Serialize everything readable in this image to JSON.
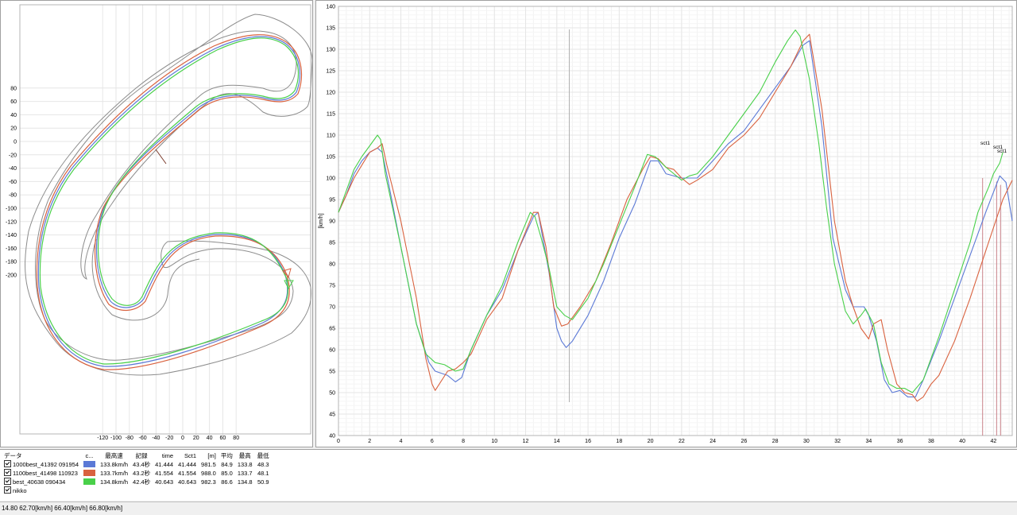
{
  "colors": {
    "blue": "#5b79d6",
    "red": "#d9623f",
    "green": "#49d04a",
    "boundary": "#8c8c8c",
    "grid": "#e6e6e6"
  },
  "track_map": {
    "x_ticks": [
      "-120",
      "-100",
      "-80",
      "-60",
      "-40",
      "-20",
      "0",
      "20",
      "40",
      "60",
      "80"
    ],
    "y_ticks": [
      "80",
      "60",
      "40",
      "20",
      "0",
      "-20",
      "-40",
      "-60",
      "-80",
      "-100",
      "-120",
      "-140",
      "-160",
      "-180",
      "-200"
    ]
  },
  "chart_data": {
    "type": "line",
    "ylabel": "[km/h]",
    "xlim": [
      0,
      43.2
    ],
    "ylim": [
      40,
      140
    ],
    "x_ticks": [
      "0",
      "2",
      "4",
      "6",
      "8",
      "10",
      "12",
      "14",
      "16",
      "18",
      "20",
      "22",
      "24",
      "26",
      "28",
      "30",
      "32",
      "34",
      "36",
      "38",
      "40",
      "42"
    ],
    "y_ticks": [
      "40",
      "45",
      "50",
      "55",
      "60",
      "65",
      "70",
      "75",
      "80",
      "85",
      "90",
      "95",
      "100",
      "105",
      "110",
      "115",
      "120",
      "125",
      "130",
      "135",
      "140"
    ],
    "cursor_x": 14.8,
    "series": [
      {
        "name": "1000best_41392 091954",
        "color": "blue",
        "points": [
          [
            0,
            92
          ],
          [
            0.5,
            96
          ],
          [
            1,
            101
          ],
          [
            1.5,
            104
          ],
          [
            2,
            106
          ],
          [
            2.5,
            107
          ],
          [
            2.8,
            106
          ],
          [
            3.2,
            99
          ],
          [
            4,
            84
          ],
          [
            5,
            66
          ],
          [
            5.8,
            57
          ],
          [
            6.2,
            55
          ],
          [
            7,
            54
          ],
          [
            7.5,
            52.5
          ],
          [
            7.9,
            53.5
          ],
          [
            8.5,
            60
          ],
          [
            9.5,
            68
          ],
          [
            10.5,
            74
          ],
          [
            11.5,
            83
          ],
          [
            12.5,
            91
          ],
          [
            12.8,
            92
          ],
          [
            13.5,
            78
          ],
          [
            14,
            65
          ],
          [
            14.3,
            62
          ],
          [
            14.6,
            60.5
          ],
          [
            15,
            62
          ],
          [
            16,
            68
          ],
          [
            17,
            76
          ],
          [
            18,
            86
          ],
          [
            19,
            94
          ],
          [
            20,
            104
          ],
          [
            20.5,
            104
          ],
          [
            21,
            101
          ],
          [
            22,
            100
          ],
          [
            23,
            100
          ],
          [
            24,
            104
          ],
          [
            25,
            108
          ],
          [
            26,
            111
          ],
          [
            27,
            116
          ],
          [
            28,
            121
          ],
          [
            29,
            126
          ],
          [
            29.8,
            131
          ],
          [
            30.2,
            132
          ],
          [
            31,
            112
          ],
          [
            31.7,
            86
          ],
          [
            32.5,
            74
          ],
          [
            33,
            70
          ],
          [
            33.7,
            70
          ],
          [
            34,
            68
          ],
          [
            34.5,
            62
          ],
          [
            35,
            53
          ],
          [
            35.5,
            50
          ],
          [
            36,
            50.5
          ],
          [
            36.5,
            49
          ],
          [
            37,
            49
          ],
          [
            37.5,
            53
          ],
          [
            38.5,
            62
          ],
          [
            39.5,
            72
          ],
          [
            40.5,
            82
          ],
          [
            41.5,
            92
          ],
          [
            42.4,
            100.5
          ],
          [
            42.8,
            99
          ],
          [
            43.2,
            90
          ]
        ]
      },
      {
        "name": "1100best_41498 110923",
        "color": "red",
        "points": [
          [
            0,
            92
          ],
          [
            0.5,
            96
          ],
          [
            1,
            100
          ],
          [
            1.5,
            103
          ],
          [
            2,
            106
          ],
          [
            2.5,
            107
          ],
          [
            2.8,
            108
          ],
          [
            3.1,
            103
          ],
          [
            4,
            90
          ],
          [
            5,
            72
          ],
          [
            5.6,
            58
          ],
          [
            6,
            52
          ],
          [
            6.2,
            50.5
          ],
          [
            7,
            55
          ],
          [
            7.5,
            55.5
          ],
          [
            8,
            57
          ],
          [
            8.5,
            59
          ],
          [
            9.5,
            67
          ],
          [
            10.5,
            72
          ],
          [
            11.5,
            83
          ],
          [
            12.5,
            92
          ],
          [
            12.8,
            92
          ],
          [
            13.3,
            84
          ],
          [
            13.8,
            70
          ],
          [
            14.3,
            65.5
          ],
          [
            14.7,
            66
          ],
          [
            15.5,
            70
          ],
          [
            16.5,
            76
          ],
          [
            17.5,
            85
          ],
          [
            18.5,
            95
          ],
          [
            19.5,
            102
          ],
          [
            20,
            105
          ],
          [
            20.5,
            104.5
          ],
          [
            21,
            102.5
          ],
          [
            21.5,
            102
          ],
          [
            22,
            100
          ],
          [
            22.5,
            98.5
          ],
          [
            23,
            99.5
          ],
          [
            24,
            102
          ],
          [
            25,
            107
          ],
          [
            26,
            110
          ],
          [
            27,
            114
          ],
          [
            28,
            120
          ],
          [
            29,
            126
          ],
          [
            29.8,
            132
          ],
          [
            30.2,
            133.5
          ],
          [
            31,
            116
          ],
          [
            31.8,
            90
          ],
          [
            32.5,
            76
          ],
          [
            33,
            70
          ],
          [
            33.5,
            65
          ],
          [
            34,
            62.5
          ],
          [
            34.3,
            66
          ],
          [
            34.8,
            67
          ],
          [
            35.2,
            60
          ],
          [
            35.8,
            52
          ],
          [
            36.3,
            50
          ],
          [
            36.8,
            49.5
          ],
          [
            37.1,
            48
          ],
          [
            37.5,
            49
          ],
          [
            38,
            52
          ],
          [
            38.5,
            54
          ],
          [
            39.5,
            62
          ],
          [
            40.5,
            72
          ],
          [
            41.5,
            83
          ],
          [
            42.6,
            95
          ],
          [
            43.2,
            99.5
          ]
        ]
      },
      {
        "name": "best_40638 090434",
        "color": "green",
        "points": [
          [
            0,
            92
          ],
          [
            0.5,
            97
          ],
          [
            1,
            102
          ],
          [
            1.5,
            105
          ],
          [
            2,
            107.5
          ],
          [
            2.5,
            110
          ],
          [
            2.7,
            109
          ],
          [
            3,
            101
          ],
          [
            4,
            84
          ],
          [
            5,
            66
          ],
          [
            5.6,
            59
          ],
          [
            6.2,
            57
          ],
          [
            6.8,
            56.5
          ],
          [
            7.5,
            55
          ],
          [
            8,
            55.5
          ],
          [
            8.5,
            60
          ],
          [
            9.5,
            68
          ],
          [
            10.5,
            75
          ],
          [
            11.5,
            85
          ],
          [
            12.3,
            92
          ],
          [
            12.6,
            91
          ],
          [
            13,
            86
          ],
          [
            13.5,
            79
          ],
          [
            14,
            70
          ],
          [
            14.5,
            68
          ],
          [
            15,
            67
          ],
          [
            16,
            72
          ],
          [
            17,
            80
          ],
          [
            18,
            89
          ],
          [
            19,
            98
          ],
          [
            19.8,
            105.5
          ],
          [
            20.3,
            105
          ],
          [
            21,
            102.5
          ],
          [
            22,
            99.5
          ],
          [
            22.5,
            100.5
          ],
          [
            23,
            101
          ],
          [
            24,
            105
          ],
          [
            25,
            110
          ],
          [
            26,
            115
          ],
          [
            27,
            120
          ],
          [
            28,
            127
          ],
          [
            28.8,
            132
          ],
          [
            29.3,
            134.5
          ],
          [
            29.6,
            133
          ],
          [
            30.2,
            123
          ],
          [
            30.8,
            108
          ],
          [
            31.3,
            93
          ],
          [
            31.8,
            80
          ],
          [
            32.5,
            69
          ],
          [
            33,
            66
          ],
          [
            33.5,
            68
          ],
          [
            33.8,
            69.5
          ],
          [
            34.3,
            66
          ],
          [
            34.8,
            57
          ],
          [
            35.3,
            52
          ],
          [
            35.8,
            51
          ],
          [
            36.3,
            51
          ],
          [
            36.8,
            50
          ],
          [
            37.5,
            53
          ],
          [
            38.5,
            63
          ],
          [
            39.5,
            74
          ],
          [
            40.5,
            85
          ],
          [
            41,
            92
          ],
          [
            41.7,
            98
          ],
          [
            42,
            101
          ],
          [
            42.4,
            103.5
          ],
          [
            42.6,
            106
          ]
        ]
      }
    ],
    "annotations": [
      "sct1",
      "sct1",
      "sct1"
    ],
    "markers_x": [
      41.3,
      42.2,
      42.45
    ]
  },
  "legend": {
    "headers": [
      "データ",
      "c...",
      "最高速",
      "記録",
      "time",
      "Sct1",
      "[m]",
      "平均",
      "最高",
      "最低"
    ],
    "rows": [
      {
        "name": "1000best_41392 091954",
        "color": "blue",
        "top_speed": "133.8km/h",
        "record": "43.4秒",
        "time": "41.444",
        "sct1": "41.444",
        "m": "981.5",
        "avg": "84.9",
        "max": "133.8",
        "min": "48.3"
      },
      {
        "name": "1100best_41498 110923",
        "color": "red",
        "top_speed": "133.7km/h",
        "record": "43.2秒",
        "time": "41.554",
        "sct1": "41.554",
        "m": "988.0",
        "avg": "85.0",
        "max": "133.7",
        "min": "48.1"
      },
      {
        "name": "best_40638 090434",
        "color": "green",
        "top_speed": "134.8km/h",
        "record": "42.4秒",
        "time": "40.643",
        "sct1": "40.643",
        "m": "982.3",
        "avg": "86.6",
        "max": "134.8",
        "min": "50.9"
      }
    ],
    "extra_row": "nikko"
  },
  "status_bar": "14.80 62.70[km/h] 66.40[km/h] 66.80[km/h]"
}
